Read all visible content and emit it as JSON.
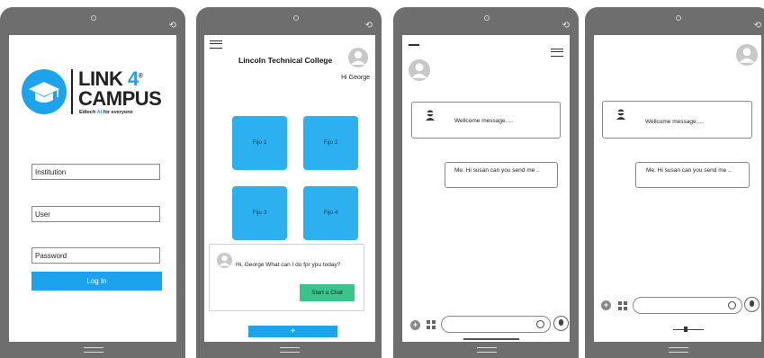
{
  "login": {
    "brand_line1": "LINK",
    "brand_four": "4",
    "brand_reg": "®",
    "brand_line2": "CAMPUS",
    "tagline_pre": "Edtech ",
    "tagline_ai": "AI",
    "tagline_post": " for everyone",
    "institution_value": "Institution",
    "user_value": "User",
    "password_value": "Password",
    "login_label": "Log In"
  },
  "home": {
    "college_name": "Lincoln Technical College",
    "greeting": "Hi George",
    "tiles": [
      "Fijo 1",
      "Fijo 2",
      "Fijo 3",
      "Fijo 4"
    ],
    "assistant_message": "Hi, George What can I do fpr ypu today?",
    "start_chat_label": "Start a Chat",
    "add_label": "+"
  },
  "chat": {
    "welcome": "Wellcome message.....",
    "me_message": "Me:  Hi susan can you send me ..",
    "plus": "+",
    "emoji": "☺"
  },
  "colors": {
    "accent": "#1ca3ec",
    "tile": "#2cb0f0",
    "start_chat": "#39c48c",
    "frame": "#6e6e6e"
  }
}
